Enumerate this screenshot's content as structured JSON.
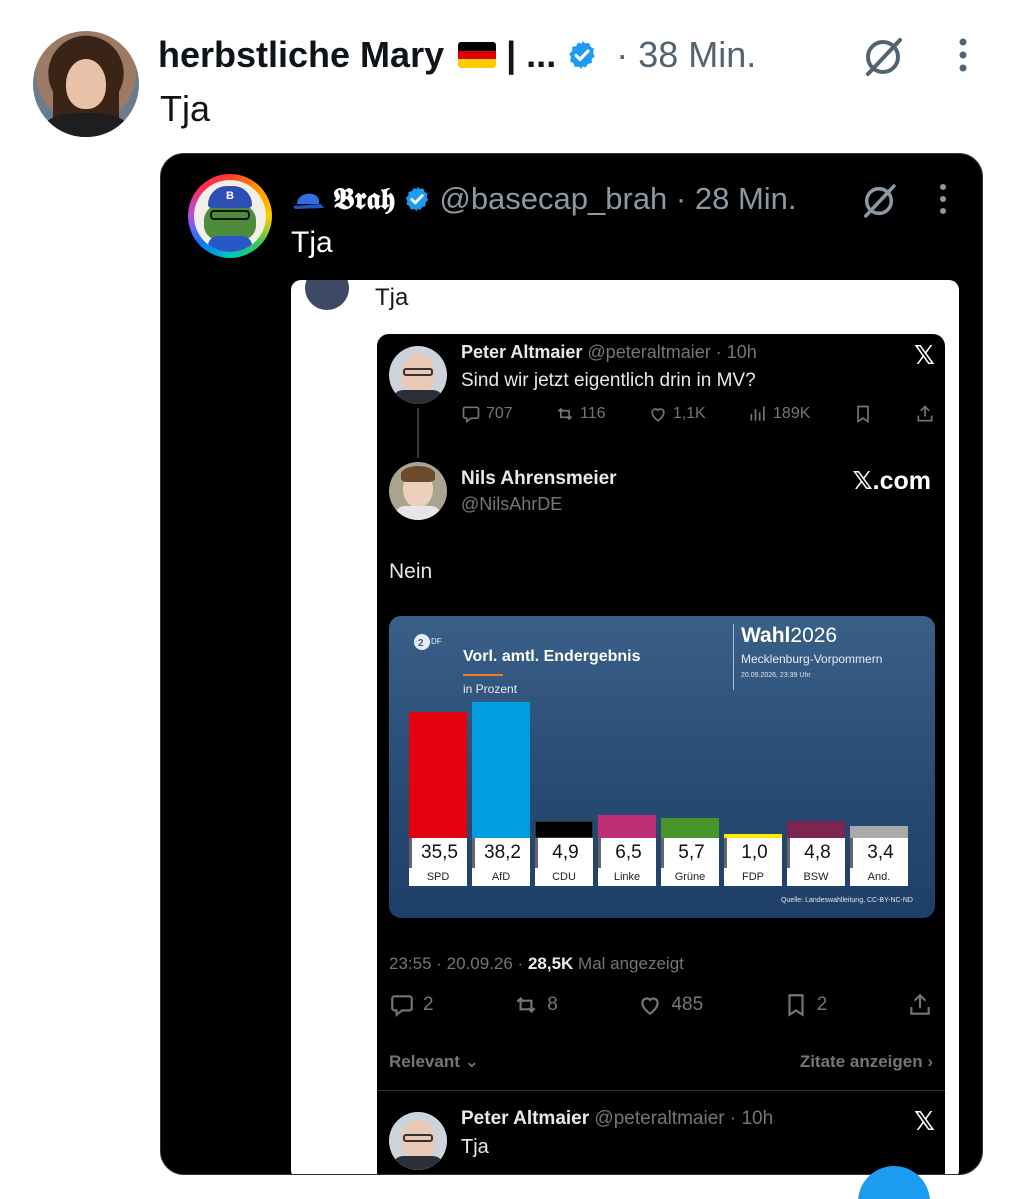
{
  "outer_tweet": {
    "author_name": "herbstliche Mary",
    "name_ellipsis": "| ...",
    "time": "· 38 Min.",
    "text": "Tja"
  },
  "quoted_tweet": {
    "author_name": "𝕭𝖗𝖆𝖍",
    "handle_time": "@basecap_brah · 28 Min.",
    "text": "Tja"
  },
  "embedded_screenshot": {
    "top_text": "Tja",
    "post1": {
      "name": "Peter Altmaier",
      "handle_time": "@peteraltmaier · 10h",
      "x_mark": "𝕏",
      "text": "Sind wir jetzt eigentlich drin in MV?",
      "replies": "707",
      "reposts": "116",
      "likes": "1,1K",
      "views": "189K"
    },
    "post2": {
      "name": "Nils Ahrensmeier",
      "handle": "@NilsAhrDE",
      "brand": "𝕏.com",
      "text": "Nein",
      "meta_time": "23:55 · 20.09.26 · ",
      "meta_views": "28,5K",
      "meta_suffix": " Mal angezeigt",
      "replies": "2",
      "reposts": "8",
      "likes": "485",
      "bookmarks": "2",
      "sort_label": "Relevant ⌄",
      "quotes_link": "Zitate anzeigen ›"
    },
    "post3": {
      "name": "Peter Altmaier",
      "handle_time": "@peteraltmaier · 10h",
      "x_mark": "𝕏",
      "text": "Tja"
    }
  },
  "chart_data": {
    "type": "bar",
    "title": "Vorl. amtl. Endergebnis",
    "unit": "in Prozent",
    "wahl_prefix": "Wahl",
    "wahl_year": "2026",
    "region": "Mecklenburg-Vorpommern",
    "date": "20.09.2026, 23:39 Uhr",
    "source": "Quelle: Landeswahlleitung, CC-BY-NC-ND",
    "categories": [
      "SPD",
      "AfD",
      "CDU",
      "Linke",
      "Grüne",
      "FDP",
      "BSW",
      "And."
    ],
    "values": [
      35.5,
      38.2,
      4.9,
      6.5,
      5.7,
      1.0,
      4.8,
      3.4
    ],
    "value_labels": [
      "35,5",
      "38,2",
      "4,9",
      "6,5",
      "5,7",
      "1,0",
      "4,8",
      "3,4"
    ],
    "colors": [
      "#e3000f",
      "#009ee0",
      "#000000",
      "#be3075",
      "#46962b",
      "#ffed00",
      "#7d254f",
      "#aaaaaa"
    ],
    "ylim": [
      0,
      40
    ]
  },
  "colors": {
    "verified_blue": "#1d9bf0",
    "dark_bg": "#000000",
    "muted_text": "#71767b"
  }
}
